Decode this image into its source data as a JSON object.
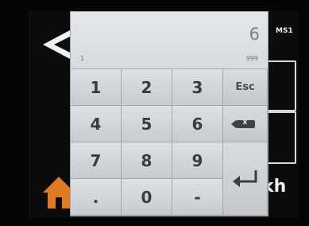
{
  "status": {
    "badge": "MS1"
  },
  "background": {
    "unit_text": "kh"
  },
  "keypad": {
    "display": {
      "value": "6",
      "min": "1",
      "max": "999"
    },
    "keys": [
      "1",
      "2",
      "3",
      "4",
      "5",
      "6",
      "7",
      "8",
      "9",
      ".",
      "0",
      "-"
    ],
    "esc_label": "Esc"
  },
  "icons": {
    "back": "back-arrow-icon",
    "home": "home-icon",
    "backspace": "backspace-icon",
    "enter": "enter-icon"
  },
  "colors": {
    "keypad_bg": "#c9ced3",
    "home_orange": "#e07a22"
  }
}
